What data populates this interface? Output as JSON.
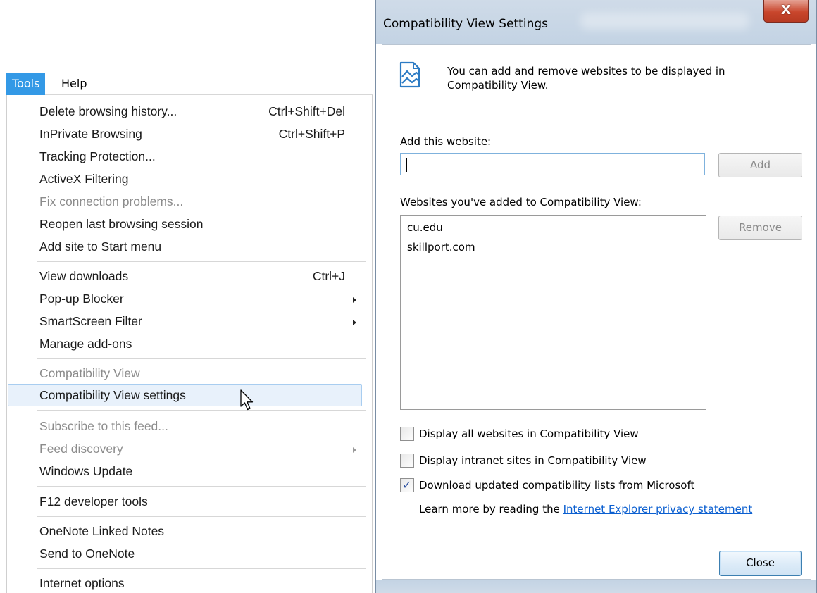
{
  "menubar": {
    "items": [
      "Tools",
      "Help"
    ]
  },
  "tools_menu": {
    "items": [
      {
        "label": "Delete browsing history...",
        "shortcut": "Ctrl+Shift+Del"
      },
      {
        "label": "InPrivate Browsing",
        "shortcut": "Ctrl+Shift+P"
      },
      {
        "label": "Tracking Protection..."
      },
      {
        "label": "ActiveX Filtering"
      },
      {
        "label": "Fix connection problems...",
        "disabled": true
      },
      {
        "label": "Reopen last browsing session"
      },
      {
        "label": "Add site to Start menu"
      },
      {
        "label": "View downloads",
        "shortcut": "Ctrl+J"
      },
      {
        "label": "Pop-up Blocker",
        "submenu": true
      },
      {
        "label": "SmartScreen Filter",
        "submenu": true
      },
      {
        "label": "Manage add-ons"
      },
      {
        "label": "Compatibility View",
        "disabled": true
      },
      {
        "label": "Compatibility View settings",
        "highlighted": true
      },
      {
        "label": "Subscribe to this feed...",
        "disabled": true
      },
      {
        "label": "Feed discovery",
        "disabled": true,
        "submenu": true
      },
      {
        "label": "Windows Update"
      },
      {
        "label": "F12 developer tools"
      },
      {
        "label": "OneNote Linked Notes"
      },
      {
        "label": "Send to OneNote"
      },
      {
        "label": "Internet options"
      }
    ]
  },
  "dialog": {
    "title": "Compatibility View Settings",
    "close_glyph": "X",
    "info_text": "You can add and remove websites to be displayed in Compatibility View.",
    "add_label": "Add this website:",
    "add_input_value": "",
    "add_button": "Add",
    "list_label": "Websites you've added to Compatibility View:",
    "sites": [
      "cu.edu",
      "skillport.com"
    ],
    "remove_button": "Remove",
    "checkboxes": [
      {
        "label": "Display all websites in Compatibility View",
        "checked": false
      },
      {
        "label": "Display intranet sites in Compatibility View",
        "checked": false
      },
      {
        "label": "Download updated compatibility lists from Microsoft",
        "checked": true
      }
    ],
    "checkmark_glyph": "✓",
    "learn_more_text": "Learn more by reading the",
    "learn_more_link": "Internet Explorer privacy statement",
    "close_button": "Close"
  }
}
